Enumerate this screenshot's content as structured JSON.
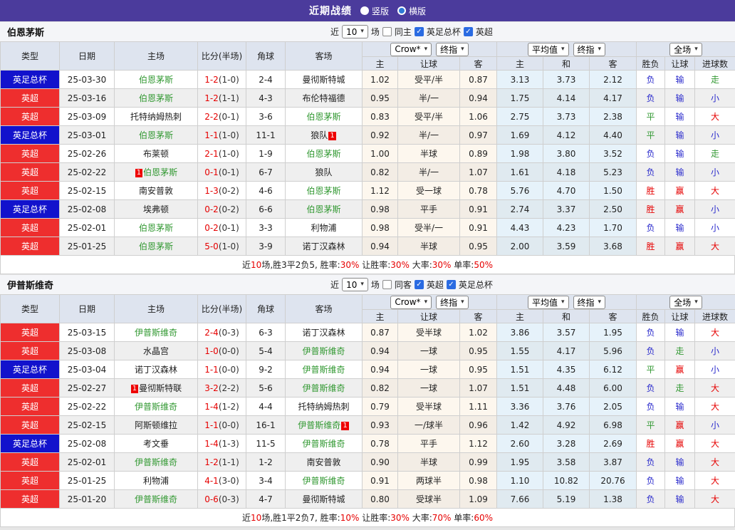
{
  "title_bar": {
    "title": "近期战绩",
    "radio_vertical": "竖版",
    "radio_horizontal": "横版",
    "selected": "横版"
  },
  "icons": {
    "caret_icon": "▾",
    "check_icon": "✓"
  },
  "colors": {
    "title_bar": "#4B3B9C",
    "league_red": "#EE2E2E",
    "league_blue": "#1212CC",
    "team_green": "#339933",
    "stat_red": "#E60000",
    "stat_blue": "#2929CC",
    "header_bg": "#DEE4EF"
  },
  "table_headers": {
    "left": [
      "类型",
      "日期",
      "主场",
      "比分(半场)",
      "角球",
      "客场"
    ],
    "odds_sub": [
      "主",
      "让球",
      "客"
    ],
    "avg_sub": [
      "主",
      "和",
      "客"
    ],
    "result_sub": [
      "胜负",
      "让球",
      "进球数"
    ],
    "selects": {
      "bookmaker": "Crow*",
      "final1": "终指",
      "average": "平均值",
      "final2": "终指",
      "fulltime": "全场"
    }
  },
  "result_colors": {
    "胜": "red",
    "平": "green",
    "负": "blue",
    "赢": "red",
    "走": "green",
    "输": "blue",
    "大": "red",
    "小": "blue"
  },
  "sections": [
    {
      "team": "伯恩茅斯",
      "filter": {
        "near": "近",
        "count": "10",
        "games": "场",
        "same": {
          "label": "同主",
          "checked": false
        },
        "leagues": [
          {
            "label": "英足总杯",
            "checked": true
          },
          {
            "label": "英超",
            "checked": true
          }
        ]
      },
      "rows": [
        {
          "league": "英足总杯",
          "league_color": "blue",
          "date": "25-03-30",
          "home": {
            "name": "伯恩茅斯",
            "green": true
          },
          "score_ft": "1-2",
          "score_ht": "(1-0)",
          "corners": "2-4",
          "away": {
            "name": "曼彻斯特城",
            "green": false
          },
          "odds": [
            "1.02",
            "受平/半",
            "0.87"
          ],
          "avg": [
            "3.13",
            "3.73",
            "2.12"
          ],
          "result": [
            "负",
            "输",
            "走"
          ]
        },
        {
          "league": "英超",
          "league_color": "red",
          "date": "25-03-16",
          "home": {
            "name": "伯恩茅斯",
            "green": true
          },
          "score_ft": "1-2",
          "score_ht": "(1-1)",
          "corners": "4-3",
          "away": {
            "name": "布伦特福德",
            "green": false
          },
          "odds": [
            "0.95",
            "半/一",
            "0.94"
          ],
          "avg": [
            "1.75",
            "4.14",
            "4.17"
          ],
          "result": [
            "负",
            "输",
            "小"
          ]
        },
        {
          "league": "英超",
          "league_color": "red",
          "date": "25-03-09",
          "home": {
            "name": "托特纳姆热刺",
            "green": false
          },
          "score_ft": "2-2",
          "score_ht": "(0-1)",
          "corners": "3-6",
          "away": {
            "name": "伯恩茅斯",
            "green": true
          },
          "odds": [
            "0.83",
            "受平/半",
            "1.06"
          ],
          "avg": [
            "2.75",
            "3.73",
            "2.38"
          ],
          "result": [
            "平",
            "输",
            "大"
          ]
        },
        {
          "league": "英足总杯",
          "league_color": "blue",
          "date": "25-03-01",
          "home": {
            "name": "伯恩茅斯",
            "green": true
          },
          "score_ft": "1-1",
          "score_ht": "(1-0)",
          "corners": "11-1",
          "away": {
            "name": "狼队",
            "green": false,
            "card": "1",
            "card_pos": "after"
          },
          "odds": [
            "0.92",
            "半/一",
            "0.97"
          ],
          "avg": [
            "1.69",
            "4.12",
            "4.40"
          ],
          "result": [
            "平",
            "输",
            "小"
          ]
        },
        {
          "league": "英超",
          "league_color": "red",
          "date": "25-02-26",
          "home": {
            "name": "布莱顿",
            "green": false
          },
          "score_ft": "2-1",
          "score_ht": "(1-0)",
          "corners": "1-9",
          "away": {
            "name": "伯恩茅斯",
            "green": true
          },
          "odds": [
            "1.00",
            "半球",
            "0.89"
          ],
          "avg": [
            "1.98",
            "3.80",
            "3.52"
          ],
          "result": [
            "负",
            "输",
            "走"
          ]
        },
        {
          "league": "英超",
          "league_color": "red",
          "date": "25-02-22",
          "home": {
            "name": "伯恩茅斯",
            "green": true,
            "card": "1",
            "card_pos": "before"
          },
          "score_ft": "0-1",
          "score_ht": "(0-1)",
          "corners": "6-7",
          "away": {
            "name": "狼队",
            "green": false
          },
          "odds": [
            "0.82",
            "半/一",
            "1.07"
          ],
          "avg": [
            "1.61",
            "4.18",
            "5.23"
          ],
          "result": [
            "负",
            "输",
            "小"
          ]
        },
        {
          "league": "英超",
          "league_color": "red",
          "date": "25-02-15",
          "home": {
            "name": "南安普敦",
            "green": false
          },
          "score_ft": "1-3",
          "score_ht": "(0-2)",
          "corners": "4-6",
          "away": {
            "name": "伯恩茅斯",
            "green": true
          },
          "odds": [
            "1.12",
            "受一球",
            "0.78"
          ],
          "avg": [
            "5.76",
            "4.70",
            "1.50"
          ],
          "result": [
            "胜",
            "赢",
            "大"
          ]
        },
        {
          "league": "英足总杯",
          "league_color": "blue",
          "date": "25-02-08",
          "home": {
            "name": "埃弗顿",
            "green": false
          },
          "score_ft": "0-2",
          "score_ht": "(0-2)",
          "corners": "6-6",
          "away": {
            "name": "伯恩茅斯",
            "green": true
          },
          "odds": [
            "0.98",
            "平手",
            "0.91"
          ],
          "avg": [
            "2.74",
            "3.37",
            "2.50"
          ],
          "result": [
            "胜",
            "赢",
            "小"
          ]
        },
        {
          "league": "英超",
          "league_color": "red",
          "date": "25-02-01",
          "home": {
            "name": "伯恩茅斯",
            "green": true
          },
          "score_ft": "0-2",
          "score_ht": "(0-1)",
          "corners": "3-3",
          "away": {
            "name": "利物浦",
            "green": false
          },
          "odds": [
            "0.98",
            "受半/一",
            "0.91"
          ],
          "avg": [
            "4.43",
            "4.23",
            "1.70"
          ],
          "result": [
            "负",
            "输",
            "小"
          ]
        },
        {
          "league": "英超",
          "league_color": "red",
          "date": "25-01-25",
          "home": {
            "name": "伯恩茅斯",
            "green": true
          },
          "score_ft": "5-0",
          "score_ht": "(1-0)",
          "corners": "3-9",
          "away": {
            "name": "诺丁汉森林",
            "green": false
          },
          "odds": [
            "0.94",
            "半球",
            "0.95"
          ],
          "avg": [
            "2.00",
            "3.59",
            "3.68"
          ],
          "result": [
            "胜",
            "赢",
            "大"
          ]
        }
      ],
      "summary": [
        {
          "text": "近"
        },
        {
          "text": "10",
          "red": true
        },
        {
          "text": "场,胜3平2负5, 胜率:"
        },
        {
          "text": "30%",
          "red": true
        },
        {
          "text": " 让胜率:"
        },
        {
          "text": "30%",
          "red": true
        },
        {
          "text": " 大率:"
        },
        {
          "text": "30%",
          "red": true
        },
        {
          "text": " 单率:"
        },
        {
          "text": "50%",
          "red": true
        }
      ]
    },
    {
      "team": "伊普斯维奇",
      "filter": {
        "near": "近",
        "count": "10",
        "games": "场",
        "same": {
          "label": "同客",
          "checked": false
        },
        "leagues": [
          {
            "label": "英超",
            "checked": true
          },
          {
            "label": "英足总杯",
            "checked": true
          }
        ]
      },
      "rows": [
        {
          "league": "英超",
          "league_color": "red",
          "date": "25-03-15",
          "home": {
            "name": "伊普斯维奇",
            "green": true
          },
          "score_ft": "2-4",
          "score_ht": "(0-3)",
          "corners": "6-3",
          "away": {
            "name": "诺丁汉森林",
            "green": false
          },
          "odds": [
            "0.87",
            "受半球",
            "1.02"
          ],
          "avg": [
            "3.86",
            "3.57",
            "1.95"
          ],
          "result": [
            "负",
            "输",
            "大"
          ]
        },
        {
          "league": "英超",
          "league_color": "red",
          "date": "25-03-08",
          "home": {
            "name": "水晶宫",
            "green": false
          },
          "score_ft": "1-0",
          "score_ht": "(0-0)",
          "corners": "5-4",
          "away": {
            "name": "伊普斯维奇",
            "green": true
          },
          "odds": [
            "0.94",
            "一球",
            "0.95"
          ],
          "avg": [
            "1.55",
            "4.17",
            "5.96"
          ],
          "result": [
            "负",
            "走",
            "小"
          ]
        },
        {
          "league": "英足总杯",
          "league_color": "blue",
          "date": "25-03-04",
          "home": {
            "name": "诺丁汉森林",
            "green": false
          },
          "score_ft": "1-1",
          "score_ht": "(0-0)",
          "corners": "9-2",
          "away": {
            "name": "伊普斯维奇",
            "green": true
          },
          "odds": [
            "0.94",
            "一球",
            "0.95"
          ],
          "avg": [
            "1.51",
            "4.35",
            "6.12"
          ],
          "result": [
            "平",
            "赢",
            "小"
          ]
        },
        {
          "league": "英超",
          "league_color": "red",
          "date": "25-02-27",
          "home": {
            "name": "曼彻斯特联",
            "green": false,
            "card": "1",
            "card_pos": "before"
          },
          "score_ft": "3-2",
          "score_ht": "(2-2)",
          "corners": "5-6",
          "away": {
            "name": "伊普斯维奇",
            "green": true
          },
          "odds": [
            "0.82",
            "一球",
            "1.07"
          ],
          "avg": [
            "1.51",
            "4.48",
            "6.00"
          ],
          "result": [
            "负",
            "走",
            "大"
          ]
        },
        {
          "league": "英超",
          "league_color": "red",
          "date": "25-02-22",
          "home": {
            "name": "伊普斯维奇",
            "green": true
          },
          "score_ft": "1-4",
          "score_ht": "(1-2)",
          "corners": "4-4",
          "away": {
            "name": "托特纳姆热刺",
            "green": false
          },
          "odds": [
            "0.79",
            "受半球",
            "1.11"
          ],
          "avg": [
            "3.36",
            "3.76",
            "2.05"
          ],
          "result": [
            "负",
            "输",
            "大"
          ]
        },
        {
          "league": "英超",
          "league_color": "red",
          "date": "25-02-15",
          "home": {
            "name": "阿斯顿维拉",
            "green": false
          },
          "score_ft": "1-1",
          "score_ht": "(0-0)",
          "corners": "16-1",
          "away": {
            "name": "伊普斯维奇",
            "green": true,
            "card": "1",
            "card_pos": "after"
          },
          "odds": [
            "0.93",
            "一/球半",
            "0.96"
          ],
          "avg": [
            "1.42",
            "4.92",
            "6.98"
          ],
          "result": [
            "平",
            "赢",
            "小"
          ]
        },
        {
          "league": "英足总杯",
          "league_color": "blue",
          "date": "25-02-08",
          "home": {
            "name": "考文垂",
            "green": false
          },
          "score_ft": "1-4",
          "score_ht": "(1-3)",
          "corners": "11-5",
          "away": {
            "name": "伊普斯维奇",
            "green": true
          },
          "odds": [
            "0.78",
            "平手",
            "1.12"
          ],
          "avg": [
            "2.60",
            "3.28",
            "2.69"
          ],
          "result": [
            "胜",
            "赢",
            "大"
          ]
        },
        {
          "league": "英超",
          "league_color": "red",
          "date": "25-02-01",
          "home": {
            "name": "伊普斯维奇",
            "green": true
          },
          "score_ft": "1-2",
          "score_ht": "(1-1)",
          "corners": "1-2",
          "away": {
            "name": "南安普敦",
            "green": false
          },
          "odds": [
            "0.90",
            "半球",
            "0.99"
          ],
          "avg": [
            "1.95",
            "3.58",
            "3.87"
          ],
          "result": [
            "负",
            "输",
            "大"
          ]
        },
        {
          "league": "英超",
          "league_color": "red",
          "date": "25-01-25",
          "home": {
            "name": "利物浦",
            "green": false
          },
          "score_ft": "4-1",
          "score_ht": "(3-0)",
          "corners": "3-4",
          "away": {
            "name": "伊普斯维奇",
            "green": true
          },
          "odds": [
            "0.91",
            "两球半",
            "0.98"
          ],
          "avg": [
            "1.10",
            "10.82",
            "20.76"
          ],
          "result": [
            "负",
            "输",
            "大"
          ]
        },
        {
          "league": "英超",
          "league_color": "red",
          "date": "25-01-20",
          "home": {
            "name": "伊普斯维奇",
            "green": true
          },
          "score_ft": "0-6",
          "score_ht": "(0-3)",
          "corners": "4-7",
          "away": {
            "name": "曼彻斯特城",
            "green": false
          },
          "odds": [
            "0.80",
            "受球半",
            "1.09"
          ],
          "avg": [
            "7.66",
            "5.19",
            "1.38"
          ],
          "result": [
            "负",
            "输",
            "大"
          ]
        }
      ],
      "summary": [
        {
          "text": "近"
        },
        {
          "text": "10",
          "red": true
        },
        {
          "text": "场,胜1平2负7, 胜率:"
        },
        {
          "text": "10%",
          "red": true
        },
        {
          "text": " 让胜率:"
        },
        {
          "text": "30%",
          "red": true
        },
        {
          "text": " 大率:"
        },
        {
          "text": "70%",
          "red": true
        },
        {
          "text": " 单率:"
        },
        {
          "text": "60%",
          "red": true
        }
      ]
    }
  ]
}
